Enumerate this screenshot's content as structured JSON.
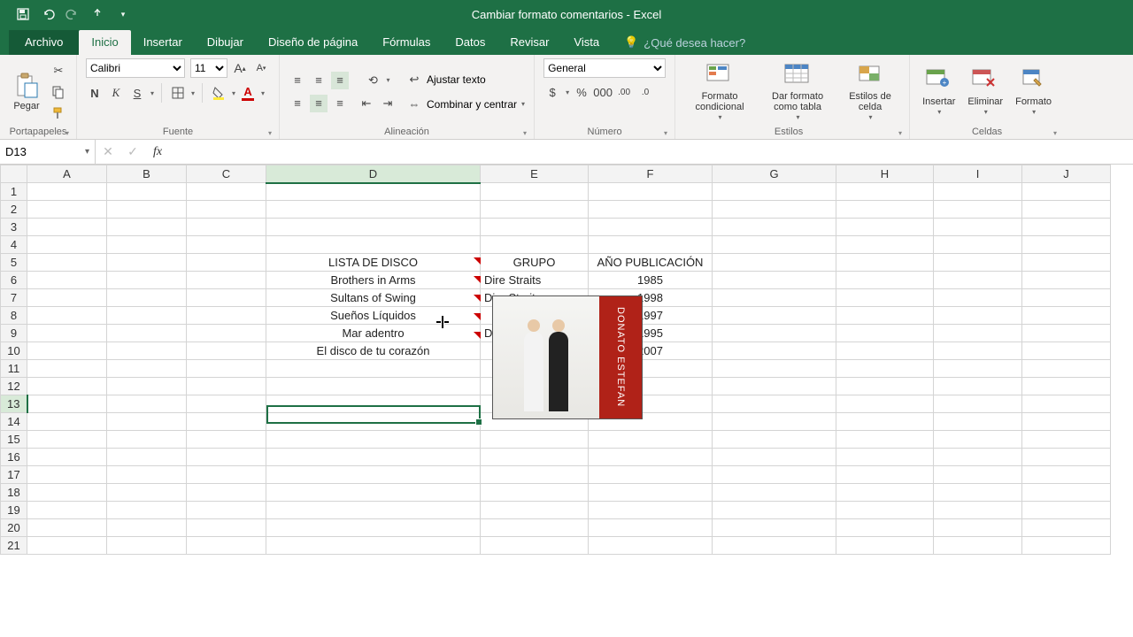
{
  "title": "Cambiar formato comentarios - Excel",
  "tabs": {
    "file": "Archivo",
    "home": "Inicio",
    "insert": "Insertar",
    "draw": "Dibujar",
    "layout": "Diseño de página",
    "formulas": "Fórmulas",
    "data": "Datos",
    "review": "Revisar",
    "view": "Vista",
    "tellme": "¿Qué desea hacer?"
  },
  "ribbon": {
    "clipboard": {
      "paste": "Pegar",
      "label": "Portapapeles"
    },
    "font": {
      "name": "Calibri",
      "size": "11",
      "label": "Fuente"
    },
    "alignment": {
      "wrap": "Ajustar texto",
      "merge": "Combinar y centrar",
      "label": "Alineación"
    },
    "number": {
      "format": "General",
      "label": "Número"
    },
    "styles": {
      "cond": "Formato condicional",
      "table": "Dar formato como tabla",
      "cell": "Estilos de celda",
      "label": "Estilos"
    },
    "cells": {
      "insert": "Insertar",
      "delete": "Eliminar",
      "format": "Formato",
      "label": "Celdas"
    }
  },
  "namebox": "D13",
  "columns": [
    "A",
    "B",
    "C",
    "D",
    "E",
    "F",
    "G",
    "H",
    "I",
    "J"
  ],
  "headers": {
    "d": "LISTA DE DISCO",
    "e": "GRUPO",
    "f": "AÑO PUBLICACIÓN"
  },
  "rows": [
    {
      "d": "Brothers in Arms",
      "e": "Dire Straits",
      "f": "1985"
    },
    {
      "d": "Sultans of Swing",
      "e": "Dire Straits",
      "f": "1998"
    },
    {
      "d": "Sueños Líquidos",
      "e": "",
      "f": "1997"
    },
    {
      "d": "Mar adentro",
      "e": "Do",
      "f": "1995"
    },
    {
      "d": "El disco de tu corazón",
      "e": "",
      "f": "2007"
    }
  ],
  "comment_caption": "DONATO ESTEFAN"
}
